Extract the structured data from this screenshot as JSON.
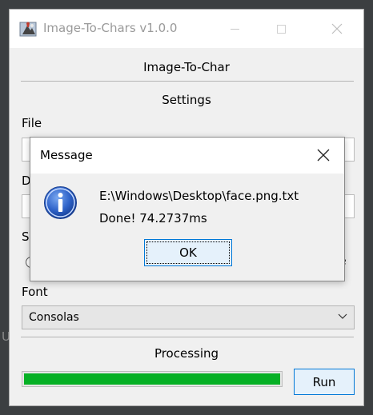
{
  "window": {
    "title": "Image-To-Chars v1.0.0",
    "heading": "Image-To-Char",
    "settings_label": "Settings",
    "file_label": "File",
    "d_label_partial": "D",
    "s_label_partial": "S",
    "font_label": "Font",
    "font_value": "Consolas",
    "stray_text_e": "e",
    "processing_label": "Processing",
    "progress_fraction": 1.0,
    "run_label": "Run",
    "progress_color": "#06b025"
  },
  "background_text": "U",
  "dialog": {
    "title": "Message",
    "line1": "E:\\Windows\\Desktop\\face.png.txt",
    "line2": "Done! 74.2737ms",
    "ok_label": "OK",
    "icon": "info-icon"
  },
  "colors": {
    "accent": "#0078d7",
    "button_bg": "#e5f1fb",
    "window_bg": "#f0f0f0"
  }
}
